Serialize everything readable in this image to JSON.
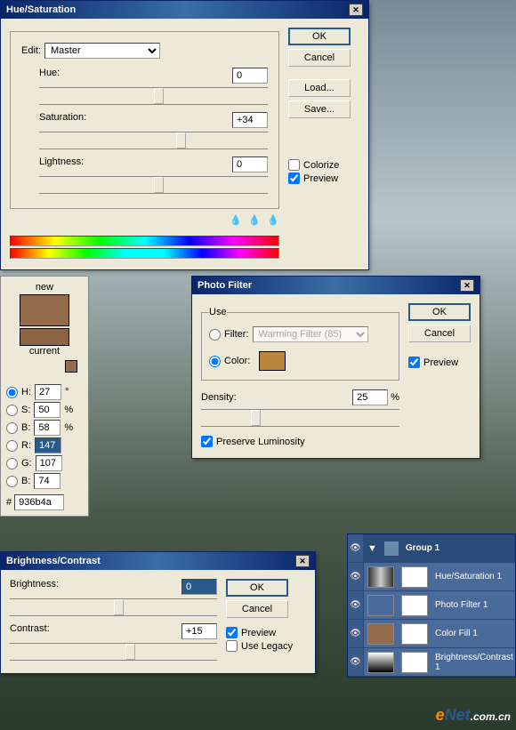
{
  "hueSat": {
    "title": "Hue/Saturation",
    "editLabel": "Edit:",
    "editValue": "Master",
    "hueLabel": "Hue:",
    "hueValue": "0",
    "satLabel": "Saturation:",
    "satValue": "+34",
    "lightLabel": "Lightness:",
    "lightValue": "0",
    "ok": "OK",
    "cancel": "Cancel",
    "load": "Load...",
    "save": "Save...",
    "colorize": "Colorize",
    "preview": "Preview"
  },
  "photoFilter": {
    "title": "Photo Filter",
    "useLabel": "Use",
    "filterLabel": "Filter:",
    "filterValue": "Warming Filter (85)",
    "colorLabel": "Color:",
    "colorSwatch": "#b8853a",
    "densityLabel": "Density:",
    "densityValue": "25",
    "percent": "%",
    "preserveLabel": "Preserve Luminosity",
    "ok": "OK",
    "cancel": "Cancel",
    "preview": "Preview"
  },
  "brightContrast": {
    "title": "Brightness/Contrast",
    "brightnessLabel": "Brightness:",
    "brightnessValue": "0",
    "contrastLabel": "Contrast:",
    "contrastValue": "+15",
    "ok": "OK",
    "cancel": "Cancel",
    "preview": "Preview",
    "useLegacy": "Use Legacy"
  },
  "colorPicker": {
    "newLabel": "new",
    "currentLabel": "current",
    "newColor": "#936b4a",
    "currentColor": "#8a6545",
    "H": {
      "label": "H:",
      "value": "27",
      "unit": "°"
    },
    "S": {
      "label": "S:",
      "value": "50",
      "unit": "%"
    },
    "B": {
      "label": "B:",
      "value": "58",
      "unit": "%"
    },
    "R": {
      "label": "R:",
      "value": "147"
    },
    "G": {
      "label": "G:",
      "value": "107"
    },
    "Bl": {
      "label": "B:",
      "value": "74"
    },
    "hexLabel": "#",
    "hexValue": "936b4a"
  },
  "layers": {
    "groupName": "Group 1",
    "items": [
      {
        "name": "Hue/Saturation 1"
      },
      {
        "name": "Photo Filter 1"
      },
      {
        "name": "Color Fill 1"
      },
      {
        "name": "Brightness/Contrast 1"
      }
    ]
  },
  "watermark": "eNet.com.cn"
}
